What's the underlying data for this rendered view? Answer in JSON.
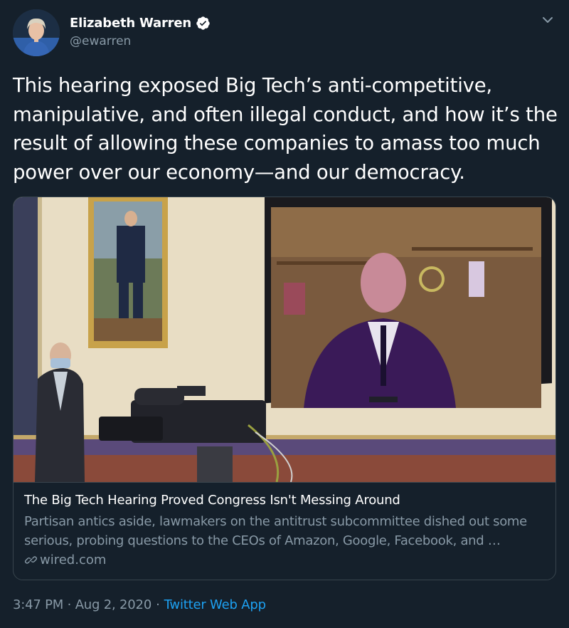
{
  "tweet": {
    "author": {
      "display_name": "Elizabeth Warren",
      "handle": "@ewarren",
      "verified": true
    },
    "text": "This hearing exposed Big Tech’s anti-competitive, manipulative, and often illegal conduct, and how it’s the result of allowing these companies to amass too much power over our economy—and our democracy.",
    "card": {
      "title": "The Big Tech Hearing Proved Congress Isn't Messing Around",
      "description": "Partisan antics aside, lawmakers on the antitrust subcommittee dished out some serious, probing questions to the CEOs of Amazon, Google, Facebook, and …",
      "domain": "wired.com"
    },
    "timestamp": "3:47 PM · Aug 2, 2020",
    "separator": "·",
    "source_app": "Twitter Web App"
  },
  "colors": {
    "background": "#15202b",
    "text_primary": "#ffffff",
    "text_secondary": "#8899a6",
    "link": "#1da1f2",
    "border": "#38444d"
  },
  "icons": {
    "verified": "verified-badge-icon",
    "menu": "chevron-down-icon",
    "link": "link-icon"
  }
}
